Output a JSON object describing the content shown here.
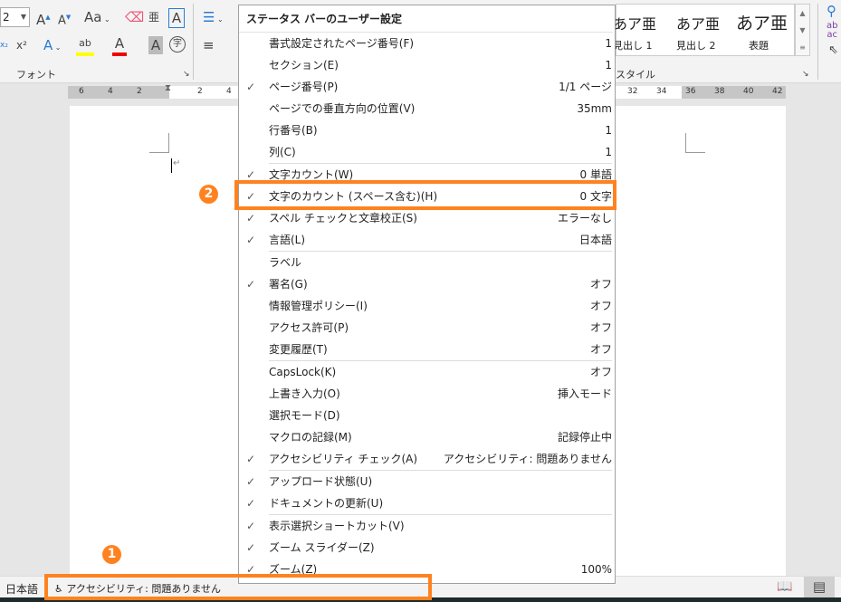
{
  "ribbon": {
    "font_size": "2",
    "groups": {
      "font": "フォント",
      "styles": "スタイル"
    },
    "styles": [
      {
        "sample": "あア亜",
        "name": "見出し 1"
      },
      {
        "sample": "あア亜",
        "name": "見出し 2"
      },
      {
        "sample": "あア亜",
        "name": "表題"
      }
    ],
    "change_case": "Aa"
  },
  "ruler": {
    "left_ticks": [
      "6",
      "4",
      "2"
    ],
    "right_ticks": [
      "2",
      "4"
    ],
    "far_ticks": [
      "32",
      "34",
      "36",
      "38",
      "40",
      "42"
    ]
  },
  "menu": {
    "title": "ステータス バーのユーザー設定",
    "items": [
      {
        "label": "書式設定されたページ番号(F)",
        "value": "1",
        "checked": false
      },
      {
        "label": "セクション(E)",
        "value": "1",
        "checked": false
      },
      {
        "label": "ページ番号(P)",
        "value": "1/1 ページ",
        "checked": true
      },
      {
        "label": "ページでの垂直方向の位置(V)",
        "value": "35mm",
        "checked": false
      },
      {
        "label": "行番号(B)",
        "value": "1",
        "checked": false
      },
      {
        "label": "列(C)",
        "value": "1",
        "checked": false,
        "sep_after": true
      },
      {
        "label": "文字カウント(W)",
        "value": "0 単語",
        "checked": true
      },
      {
        "label": "文字のカウント (スペース含む)(H)",
        "value": "0 文字",
        "checked": true
      },
      {
        "label": "スペル チェックと文章校正(S)",
        "value": "エラーなし",
        "checked": true
      },
      {
        "label": "言語(L)",
        "value": "日本語",
        "checked": true,
        "sep_after": true
      },
      {
        "label": "ラベル",
        "value": "",
        "checked": false
      },
      {
        "label": "署名(G)",
        "value": "オフ",
        "checked": true
      },
      {
        "label": "情報管理ポリシー(I)",
        "value": "オフ",
        "checked": false
      },
      {
        "label": "アクセス許可(P)",
        "value": "オフ",
        "checked": false
      },
      {
        "label": "変更履歴(T)",
        "value": "オフ",
        "checked": false,
        "sep_after": true
      },
      {
        "label": "CapsLock(K)",
        "value": "オフ",
        "checked": false
      },
      {
        "label": "上書き入力(O)",
        "value": "挿入モード",
        "checked": false
      },
      {
        "label": "選択モード(D)",
        "value": "",
        "checked": false
      },
      {
        "label": "マクロの記録(M)",
        "value": "記録停止中",
        "checked": false
      },
      {
        "label": "アクセシビリティ チェック(A)",
        "value": "アクセシビリティ: 問題ありません",
        "checked": true,
        "sep_after": true
      },
      {
        "label": "アップロード状態(U)",
        "value": "",
        "checked": true
      },
      {
        "label": "ドキュメントの更新(U)",
        "value": "",
        "checked": true,
        "sep_after": true
      },
      {
        "label": "表示選択ショートカット(V)",
        "value": "",
        "checked": true
      },
      {
        "label": "ズーム スライダー(Z)",
        "value": "",
        "checked": true
      },
      {
        "label": "ズーム(Z)",
        "value": "100%",
        "checked": true
      }
    ]
  },
  "status": {
    "language": "日本語",
    "accessibility": "アクセシビリティ: 問題ありません"
  },
  "annotations": {
    "badge1": "1",
    "badge2": "2",
    "color": "#ff8220"
  }
}
